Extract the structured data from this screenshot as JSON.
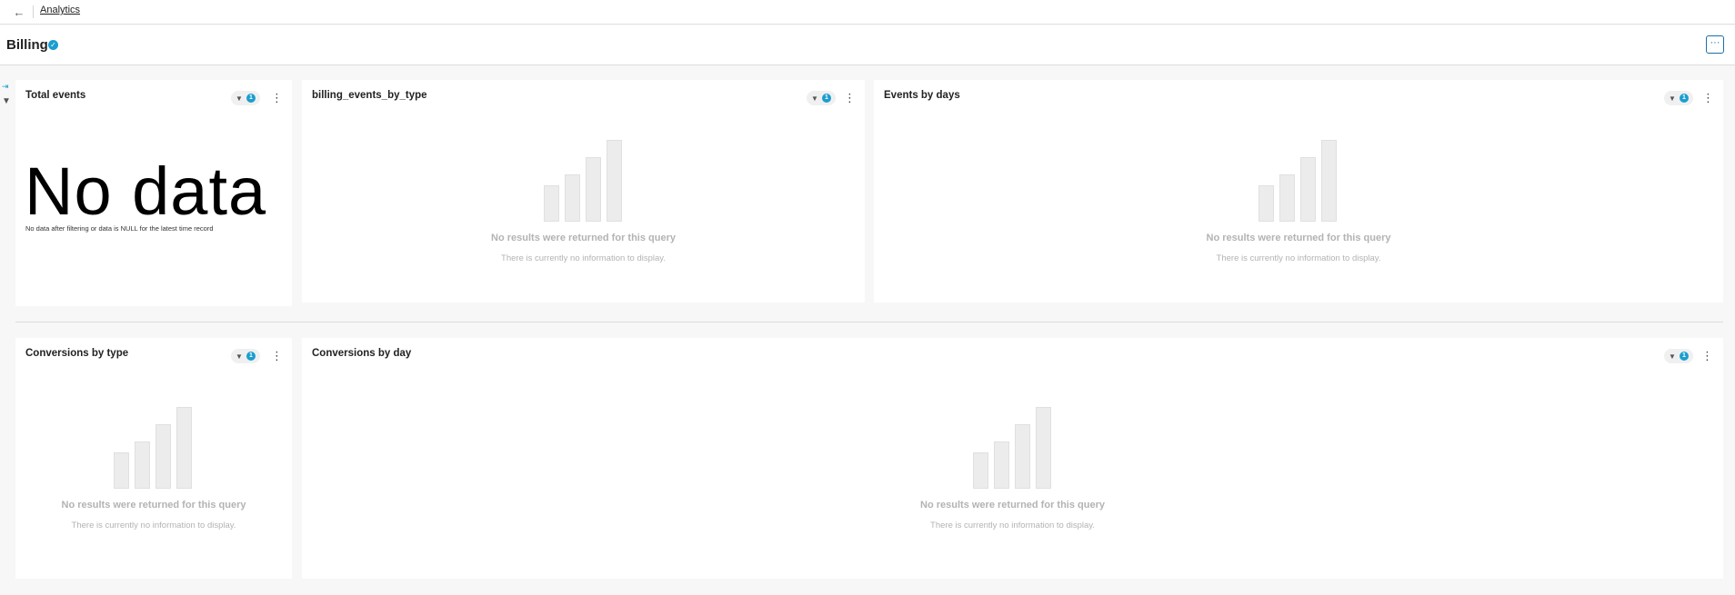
{
  "topbar": {
    "back_icon": "arrow-left-icon",
    "breadcrumb": "Analytics"
  },
  "header": {
    "title": "Billing",
    "verified_icon": "check-circle-icon",
    "more_label": "···"
  },
  "sidebar": {
    "expand_icon": "expand-icon",
    "filter_icon": "filter-icon"
  },
  "panels": [
    {
      "title": "Total events",
      "filter_count": "1",
      "big_text": "No data",
      "small_text": "No data after filtering or data is NULL for the latest time record"
    },
    {
      "title": "billing_events_by_type",
      "filter_count": "1",
      "empty_title": "No results were returned for this query",
      "empty_sub": "There is currently no information to display."
    },
    {
      "title": "Events by days",
      "filter_count": "1",
      "empty_title": "No results were returned for this query",
      "empty_sub": "There is currently no information to display."
    },
    {
      "title": "Conversions by type",
      "filter_count": "1",
      "empty_title": "No results were returned for this query",
      "empty_sub": "There is currently no information to display."
    },
    {
      "title": "Conversions by day",
      "filter_count": "1",
      "empty_title": "No results were returned for this query",
      "empty_sub": "There is currently no information to display."
    }
  ],
  "colors": {
    "accent": "#1a9ecf",
    "empty_text": "#b3b3b3"
  }
}
